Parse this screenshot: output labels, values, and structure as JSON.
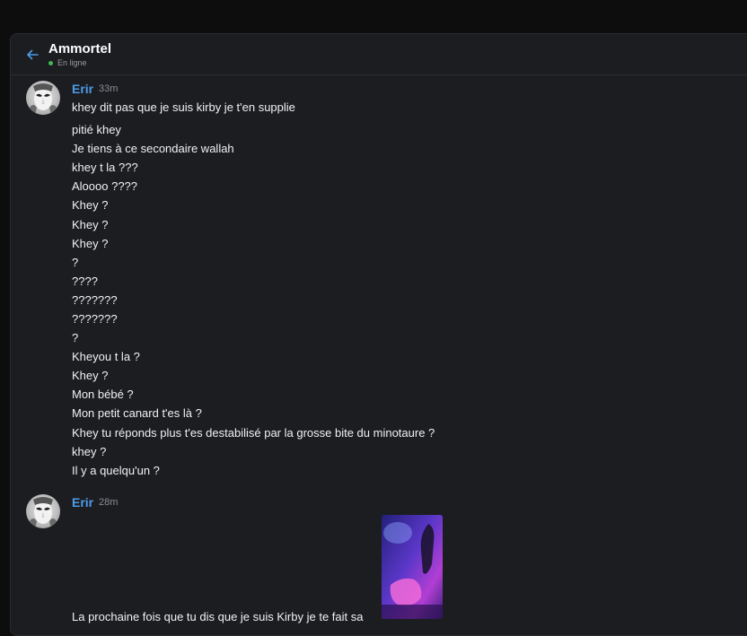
{
  "header": {
    "title": "Ammortel",
    "status": "En ligne",
    "status_color": "#3fb950",
    "accent": "#4d9be8"
  },
  "groups": [
    {
      "author": "Erir",
      "time": "33m",
      "lines": [
        "khey dit pas que je suis kirby je t'en supplie",
        "pitié khey",
        "Je tiens à ce secondaire wallah",
        "khey t la ???",
        "Aloooo ????",
        "Khey ?",
        "Khey ?",
        "Khey ?",
        "?",
        "????",
        "???????",
        "???????",
        "?",
        "Kheyou t la ?",
        "Khey ?",
        "Mon bébé ?",
        "Mon petit canard t'es là ?",
        "Khey tu réponds plus t'es destabilisé par la grosse bite du minotaure ?",
        "khey ?",
        "Il y a quelqu'un ?"
      ]
    },
    {
      "author": "Erir",
      "time": "28m",
      "caption": "La prochaine fois que tu dis que je suis Kirby je te fait sa",
      "attachment_icon": "image-attachment"
    }
  ]
}
